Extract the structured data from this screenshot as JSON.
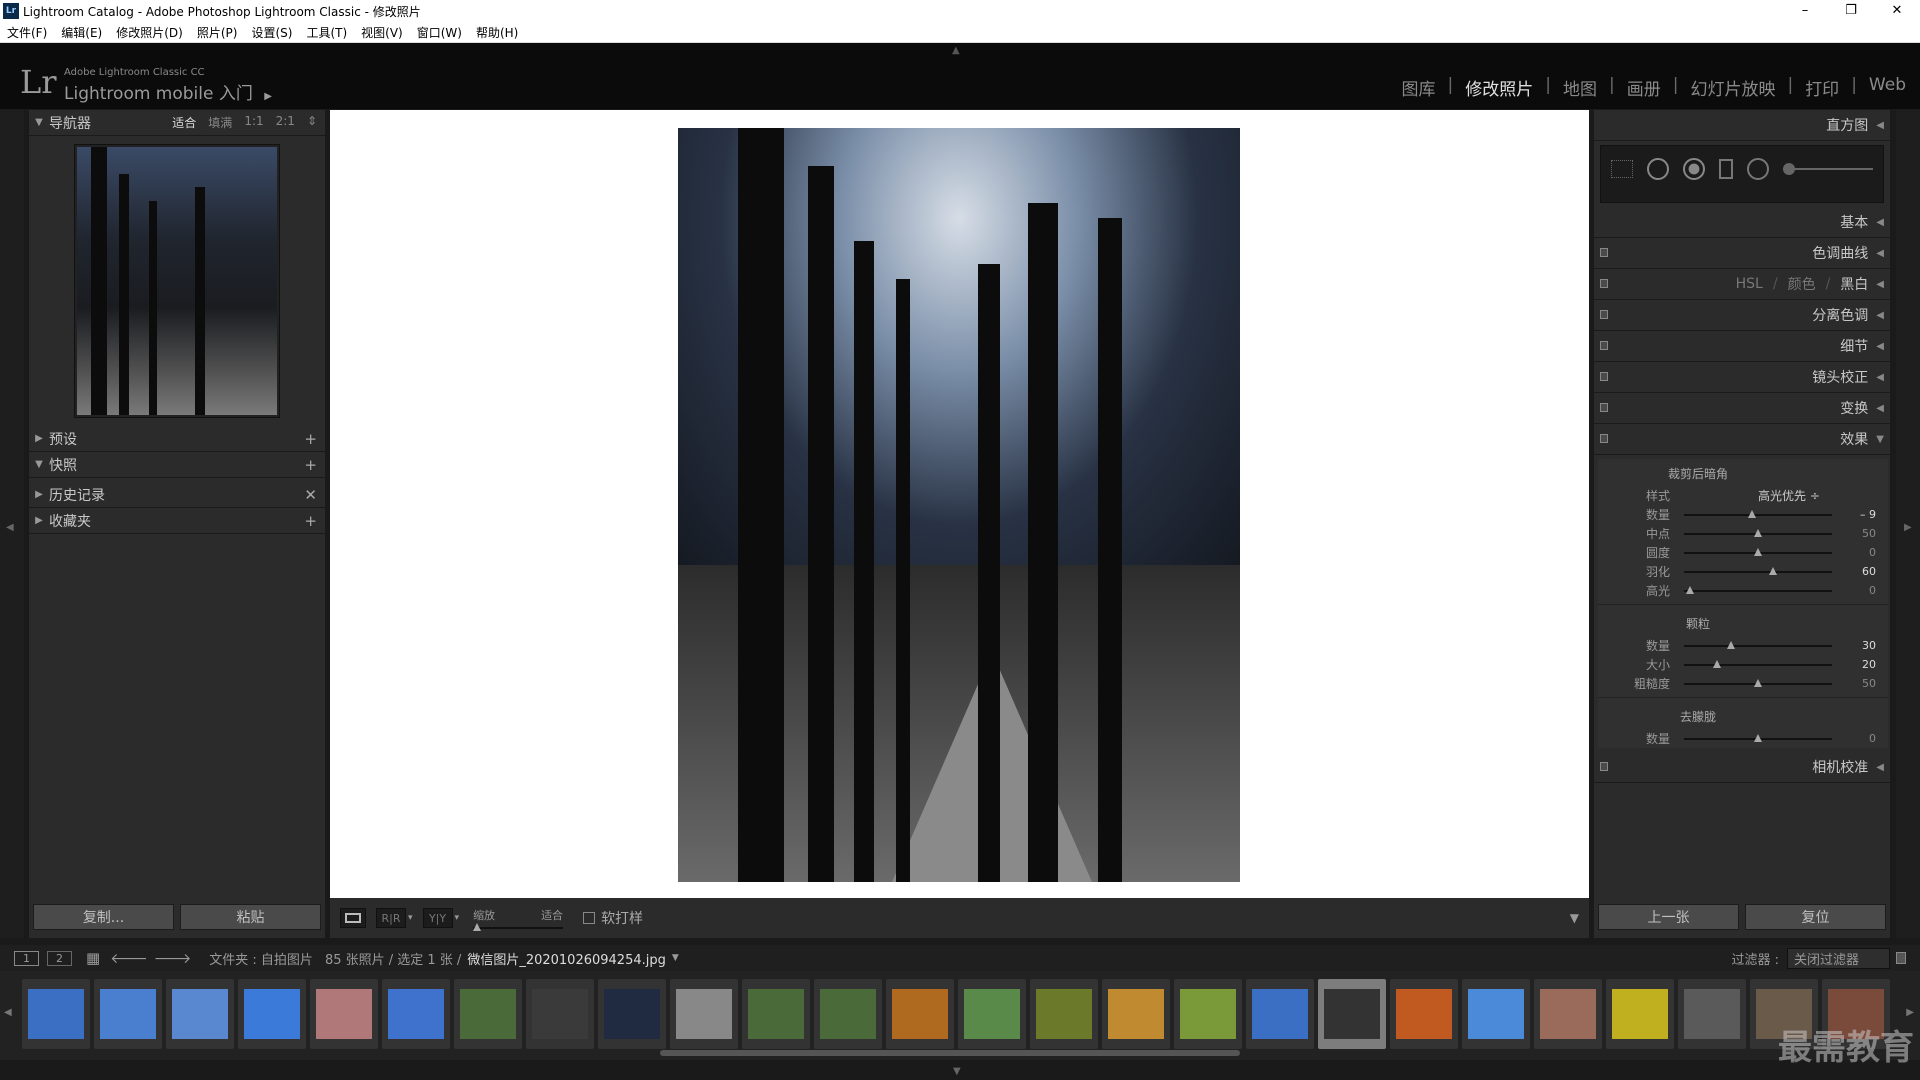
{
  "window": {
    "title": "Lightroom Catalog - Adobe Photoshop Lightroom Classic - 修改照片",
    "app_icon": "Lr",
    "minimize": "–",
    "maximize": "❐",
    "close": "✕"
  },
  "menu": [
    "文件(F)",
    "编辑(E)",
    "修改照片(D)",
    "照片(P)",
    "设置(S)",
    "工具(T)",
    "视图(V)",
    "窗口(W)",
    "帮助(H)"
  ],
  "identity": {
    "logo": "Lr",
    "small": "Adobe Lightroom Classic CC",
    "big": "Lightroom mobile 入门",
    "arrow": "▶"
  },
  "modules": [
    "图库",
    "修改照片",
    "地图",
    "画册",
    "幻灯片放映",
    "打印",
    "Web"
  ],
  "active_module": "修改照片",
  "left": {
    "navigator": {
      "title": "导航器",
      "options": [
        "适合",
        "填满",
        "1:1",
        "2:1"
      ],
      "selected": "适合",
      "more": "⇕"
    },
    "panels": [
      {
        "title": "预设",
        "action": "+"
      },
      {
        "title": "快照",
        "action": "+"
      },
      {
        "title": "历史记录",
        "action": "✕"
      },
      {
        "title": "收藏夹",
        "action": "+"
      }
    ],
    "copy": "复制...",
    "paste": "粘贴"
  },
  "toolbar": {
    "zoom_label": "缩放",
    "fit_label": "适合",
    "softproof": "软打样",
    "yy": "Y|Y",
    "rr": "R|R"
  },
  "right": {
    "histogram": "直方图",
    "panels": [
      "基本",
      "色调曲线",
      "分离色调",
      "细节",
      "镜头校正",
      "变换"
    ],
    "hsl": {
      "a": "HSL",
      "b": "颜色",
      "c": "黑白"
    },
    "effects": {
      "title": "效果",
      "vignette_title": "裁剪后暗角",
      "style_label": "样式",
      "style_value": "高光优先 ÷",
      "vignette": [
        {
          "label": "数量",
          "value": "– 9",
          "pos": 0.46
        },
        {
          "label": "中点",
          "value": "50",
          "pos": 0.5
        },
        {
          "label": "圆度",
          "value": "0",
          "pos": 0.5
        },
        {
          "label": "羽化",
          "value": "60",
          "pos": 0.6
        },
        {
          "label": "高光",
          "value": "0",
          "pos": 0.04
        }
      ],
      "grain_title": "颗粒",
      "grain": [
        {
          "label": "数量",
          "value": "30",
          "pos": 0.32
        },
        {
          "label": "大小",
          "value": "20",
          "pos": 0.22
        },
        {
          "label": "粗糙度",
          "value": "50",
          "pos": 0.5
        }
      ],
      "dehaze_title": "去朦胧",
      "dehaze": [
        {
          "label": "数量",
          "value": "0",
          "pos": 0.5
        }
      ]
    },
    "camera": "相机校准",
    "prev": "上一张",
    "reset": "复位"
  },
  "filmbar": {
    "page1": "1",
    "page2": "2",
    "path": "文件夹 : 自拍图片",
    "count": "85 张照片 / 选定 1 张 /",
    "filename": "微信图片_20201026094254.jpg",
    "filter_label": "过滤器 :",
    "filter_value": "关闭过滤器"
  },
  "watermark": "最需教育",
  "thumbs": [
    "#3a6fc4",
    "#4a7fd0",
    "#5a88d0",
    "#3b7ad8",
    "#b07878",
    "#3f72cc",
    "#4a6a3a",
    "#3a3a3a",
    "#202a40",
    "#888888",
    "#4a6a3a",
    "#4a6a3a",
    "#b06a20",
    "#5a8a4a",
    "#6a7a2a",
    "#c08a30",
    "#7a9a3a",
    "#3a6fc4",
    "#333333",
    "#c05a20",
    "#4a8ad8",
    "#9a6a5a",
    "#c0b020",
    "#5a5a5a",
    "#6a5a4a",
    "#7a4a3a"
  ],
  "selected_thumb": 18
}
